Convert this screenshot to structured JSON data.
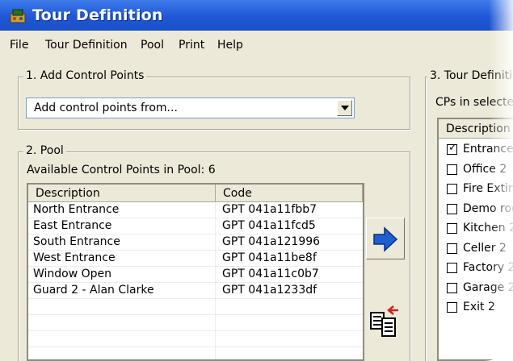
{
  "window": {
    "title": "Tour Definition",
    "icon": "tour-app-icon"
  },
  "menu": [
    "File",
    "Tour Definition",
    "Pool",
    "Print",
    "Help"
  ],
  "section1": {
    "label": "1. Add Control Points",
    "dropdown": {
      "selected": "Add control points from..."
    }
  },
  "section2": {
    "label": "2. Pool",
    "available_text": "Available Control Points in Pool: 6",
    "columns": [
      "Description",
      "Code"
    ],
    "rows": [
      {
        "description": "North Entrance",
        "code": "GPT 041a11fbb7"
      },
      {
        "description": "East Entrance",
        "code": "GPT 041a11fcd5"
      },
      {
        "description": "South Entrance",
        "code": "GPT 041a121996"
      },
      {
        "description": "West Entrance",
        "code": "GPT 041a11be8f"
      },
      {
        "description": "Window Open",
        "code": "GPT 041a11c0b7"
      },
      {
        "description": "Guard 2 - Alan Clarke",
        "code": "GPT 041a1233df"
      }
    ]
  },
  "section3": {
    "label": "3. Tour Definiti",
    "cps_label": "CPs in selecte",
    "column": "Description",
    "items": [
      {
        "label": "Entrance",
        "checked": true
      },
      {
        "label": "Office 2",
        "checked": false
      },
      {
        "label": "Fire Extin",
        "checked": false
      },
      {
        "label": "Demo roo",
        "checked": false
      },
      {
        "label": "Kitchen 2",
        "checked": false
      },
      {
        "label": "Celler 2",
        "checked": false
      },
      {
        "label": "Factory 2",
        "checked": false
      },
      {
        "label": "Garage 2",
        "checked": false
      },
      {
        "label": "Exit 2",
        "checked": false
      }
    ]
  },
  "colors": {
    "titlebar": "#1f57d6",
    "window_bg": "#ece9d8",
    "arrow_blue": "#1f5fd1"
  }
}
